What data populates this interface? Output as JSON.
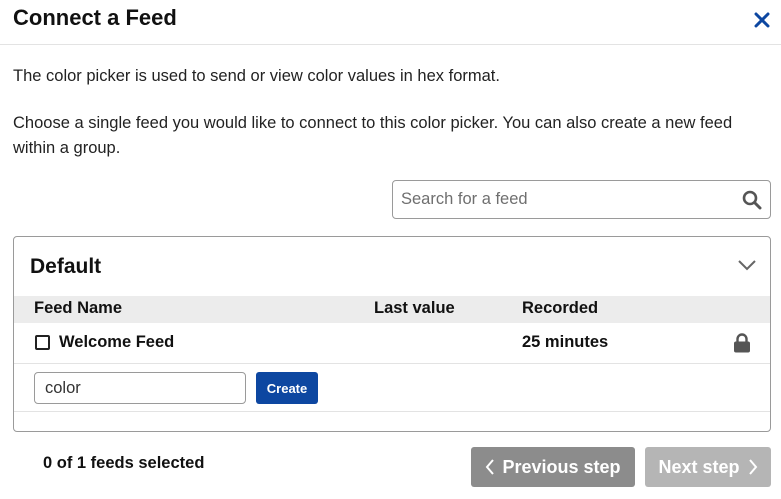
{
  "dialog": {
    "title": "Connect a Feed",
    "close_icon": "close-icon"
  },
  "description": {
    "line1": "The color picker is used to send or view color values in hex format.",
    "line2": "Choose a single feed you would like to connect to this color picker. You can also create a new feed within a group."
  },
  "search": {
    "placeholder": "Search for a feed",
    "value": "",
    "icon": "search-icon"
  },
  "group": {
    "name": "Default",
    "expand_icon": "chevron-down-icon",
    "columns": [
      "Feed Name",
      "Last value",
      "Recorded"
    ],
    "feeds": [
      {
        "name": "Welcome Feed",
        "last_value": "",
        "recorded": "25 minutes",
        "checked": false,
        "icon": "lock-icon"
      }
    ],
    "new_feed_value": "color",
    "create_label": "Create"
  },
  "footer": {
    "selected_count": "0 of 1 feeds selected",
    "previous_label": "Previous step",
    "next_label": "Next step"
  },
  "colors": {
    "accent": "#0d47a1",
    "disabled_button": "#8c8c8c",
    "disabled_button_light": "#b5b5b5",
    "table_header": "#ececec"
  }
}
